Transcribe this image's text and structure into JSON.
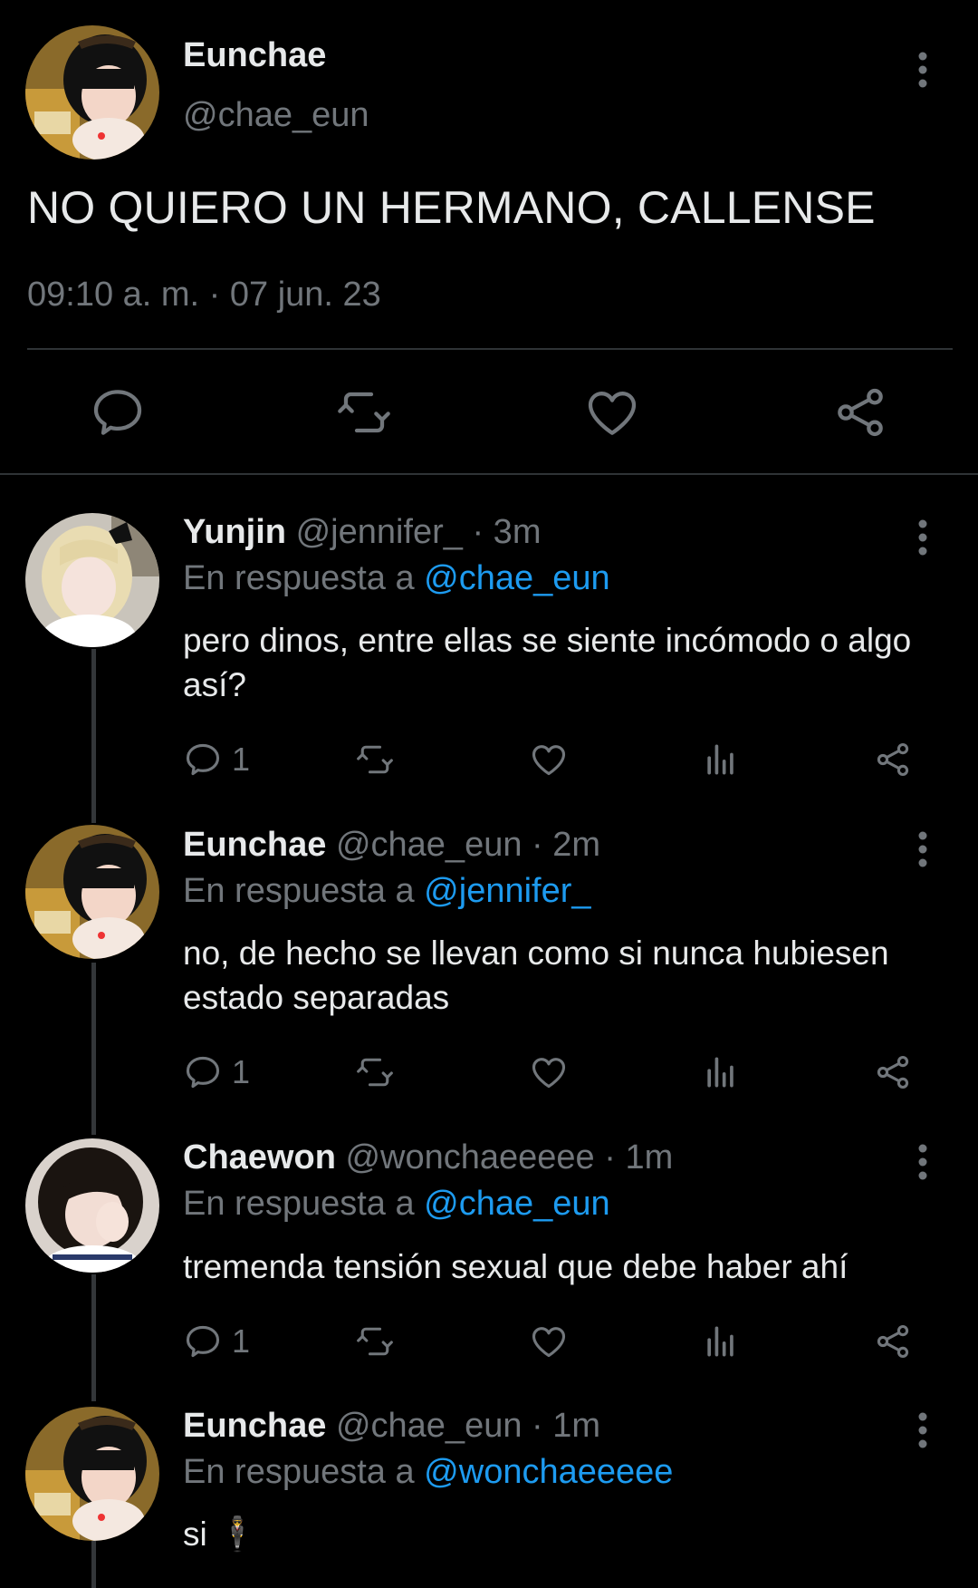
{
  "tweet": {
    "author_name": "Eunchae",
    "author_handle": "@chae_eun",
    "text": "NO QUIERO UN HERMANO, CALLENSE",
    "timestamp": "09:10 a. m. · 07 jun. 23",
    "actions": [
      "reply-icon",
      "retweet-icon",
      "like-icon",
      "share-icon"
    ]
  },
  "replies": [
    {
      "name": "Yunjin",
      "handle": "@jennifer_",
      "time": "· 3m",
      "reply_prefix": "En respuesta a",
      "reply_to": "@chae_eun",
      "text": "pero dinos, entre ellas se siente incómodo o algo así?",
      "reply_count": "1"
    },
    {
      "name": "Eunchae",
      "handle": "@chae_eun",
      "time": "· 2m",
      "reply_prefix": "En respuesta a",
      "reply_to": "@jennifer_",
      "text": "no, de hecho se llevan como si nunca hubiesen estado separadas",
      "reply_count": "1"
    },
    {
      "name": "Chaewon",
      "handle": "@wonchaeeeee",
      "time": "· 1m",
      "reply_prefix": "En respuesta a",
      "reply_to": "@chae_eun",
      "text": "tremenda tensión sexual que debe haber ahí",
      "reply_count": "1"
    },
    {
      "name": "Eunchae",
      "handle": "@chae_eun",
      "time": "· 1m",
      "reply_prefix": "En respuesta a",
      "reply_to": "@wonchaeeeee",
      "text": "si 🕴",
      "reply_count": ""
    }
  ],
  "colors": {
    "background": "#000000",
    "text": "#e7e9ea",
    "muted": "#71767b",
    "link": "#1d9bf0",
    "divider": "#2f3336"
  }
}
